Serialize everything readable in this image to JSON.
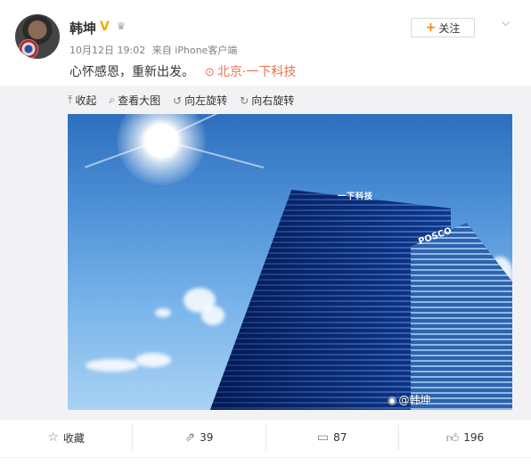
{
  "post": {
    "username": "韩坤",
    "date": "10月12日 19:02",
    "source": "来自 iPhone客户端",
    "text": "心怀感恩，重新出发。",
    "location": "北京·一下科技",
    "follow_label": "关注"
  },
  "toolbar": {
    "collapse": "收起",
    "view_large": "查看大图",
    "rotate_left": "向左旋转",
    "rotate_right": "向右旋转"
  },
  "photo": {
    "sign_a": "一下科技",
    "sign_b": "POSCO",
    "watermark": "@韩坤"
  },
  "actions": {
    "favorite_label": "收藏",
    "repost_count": "39",
    "comment_count": "87",
    "like_count": "196"
  },
  "icons": {
    "verified": "verified-v-icon",
    "crown": "crown-icon",
    "dropdown": "chevron-down-icon",
    "location": "location-pin-icon",
    "collapse": "collapse-arrow-icon",
    "zoom": "magnifier-icon",
    "rotate_left": "rotate-left-icon",
    "rotate_right": "rotate-right-icon",
    "favorite": "star-icon",
    "repost": "repost-icon",
    "comment": "comment-icon",
    "like": "thumbs-up-icon"
  },
  "colors": {
    "accent": "#ff8200",
    "location": "#eb7350",
    "verified": "#f7a800"
  }
}
